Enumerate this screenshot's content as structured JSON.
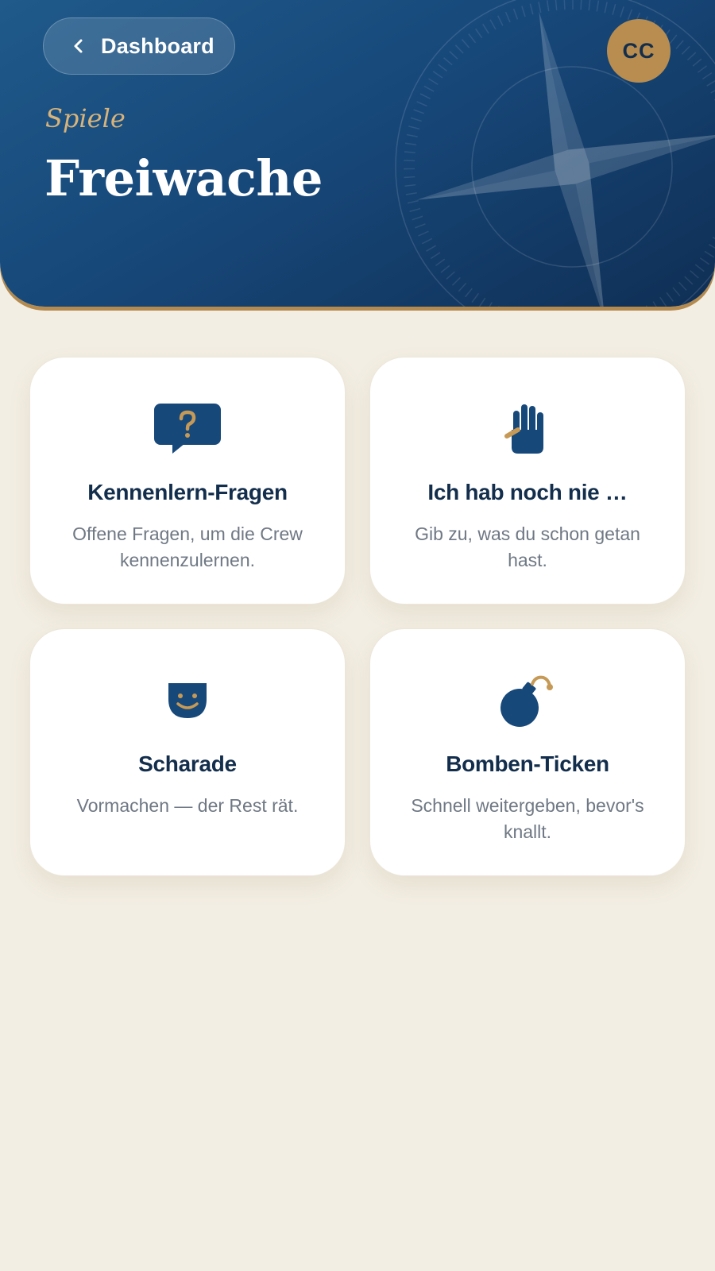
{
  "header": {
    "back_label": "Dashboard",
    "avatar_initials": "CC",
    "eyebrow": "Spiele",
    "title": "Freiwache"
  },
  "colors": {
    "navy": "#17487a",
    "navy_dark": "#132e4c",
    "gold": "#b88d4f",
    "background": "#f3eee3",
    "card": "#ffffff",
    "muted_text": "#6f7884"
  },
  "games": [
    {
      "icon": "question-bubble-icon",
      "title": "Kennenlern-Fragen",
      "description": "Offene Fragen, um die Crew kennenzulernen."
    },
    {
      "icon": "raised-hand-icon",
      "title": "Ich hab noch nie …",
      "description": "Gib zu, was du schon getan hast."
    },
    {
      "icon": "smiling-mask-icon",
      "title": "Scharade",
      "description": "Vormachen — der Rest rät."
    },
    {
      "icon": "bomb-icon",
      "title": "Bomben-Ticken",
      "description": "Schnell weitergeben, bevor's knallt."
    }
  ]
}
